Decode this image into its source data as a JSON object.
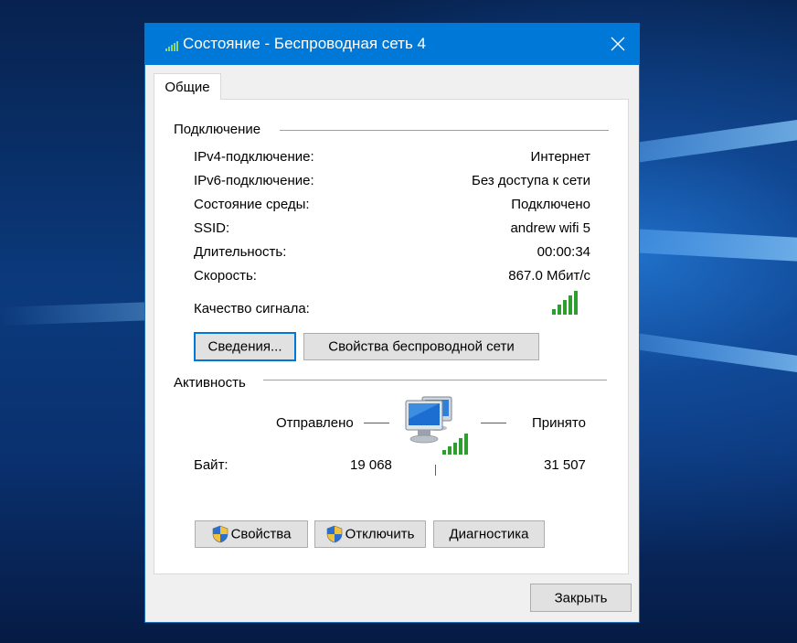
{
  "window": {
    "title": "Состояние - Беспроводная сеть 4",
    "close_icon": "close-icon",
    "accent_color": "#0078d7"
  },
  "tabs": [
    {
      "label": "Общие",
      "selected": true
    }
  ],
  "connection": {
    "heading": "Подключение",
    "rows": [
      {
        "label": "IPv4-подключение:",
        "value": "Интернет"
      },
      {
        "label": "IPv6-подключение:",
        "value": "Без доступа к сети"
      },
      {
        "label": "Состояние среды:",
        "value": "Подключено"
      },
      {
        "label": "SSID:",
        "value": "andrew wifi 5"
      },
      {
        "label": "Длительность:",
        "value": "00:00:34"
      },
      {
        "label": "Скорость:",
        "value": "867.0 Мбит/с"
      }
    ],
    "signal_label": "Качество сигнала:",
    "signal_bars": 5,
    "signal_bars_max": 5,
    "signal_color": "#2e9e2e",
    "details_button": "Сведения...",
    "wireless_props_button": "Свойства беспроводной сети"
  },
  "activity": {
    "heading": "Активность",
    "sent_label": "Отправлено",
    "received_label": "Принято",
    "bytes_label": "Байт:",
    "bytes_sent": "19 068",
    "bytes_received": "31 507",
    "icon": "network-computers-icon"
  },
  "buttons": {
    "properties": "Свойства",
    "disable": "Отключить",
    "diagnose": "Диагностика",
    "close": "Закрыть",
    "shield_icon": "uac-shield-icon"
  }
}
